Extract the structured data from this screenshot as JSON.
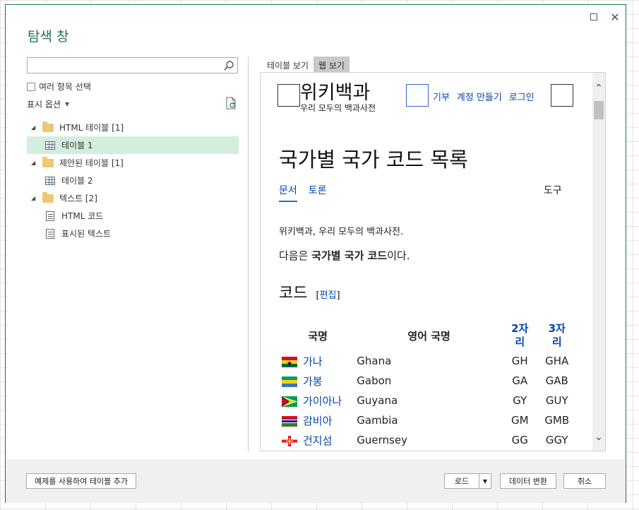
{
  "window": {
    "title": "탐색 창"
  },
  "left": {
    "search_placeholder": "",
    "multi_select_label": "여러 항목 선택",
    "display_options_label": "표시 옵션",
    "tree": [
      {
        "type": "folder",
        "label": "HTML 테이블 [1]"
      },
      {
        "type": "table",
        "label": "테이블 1",
        "selected": true
      },
      {
        "type": "folder",
        "label": "제안된 테이블 [1]"
      },
      {
        "type": "table",
        "label": "테이블 2"
      },
      {
        "type": "folder",
        "label": "텍스트 [2]"
      },
      {
        "type": "text",
        "label": "HTML 코드"
      },
      {
        "type": "text",
        "label": "표시된 텍스트"
      }
    ]
  },
  "right": {
    "tabs": [
      "테이블 보기",
      "웹 보기"
    ],
    "active_tab": "웹 보기"
  },
  "webpage": {
    "logo": "위키백과",
    "tagline": "우리 모두의 백과사전",
    "top_links": [
      "기부",
      "계정 만들기",
      "로그인"
    ],
    "heading": "국가별 국가 코드 목록",
    "page_tabs": [
      "문서",
      "토론"
    ],
    "tools": "도구",
    "intro": "위키백과, 우리 모두의 백과사전.",
    "lead_prefix": "다음은 ",
    "lead_bold": "국가별 국가 코드",
    "lead_suffix": "이다.",
    "section_title": "코드",
    "edit_label": "[편집]",
    "table_headers": [
      "국명",
      "영어 국명",
      "2자\n리",
      "3자\n리"
    ],
    "rows": [
      {
        "ko": "가나",
        "en": "Ghana",
        "a2": "GH",
        "a3": "GHA",
        "flag": "ghana"
      },
      {
        "ko": "가봉",
        "en": "Gabon",
        "a2": "GA",
        "a3": "GAB",
        "flag": "gabon"
      },
      {
        "ko": "가이아나",
        "en": "Guyana",
        "a2": "GY",
        "a3": "GUY",
        "flag": "guyana"
      },
      {
        "ko": "감비아",
        "en": "Gambia",
        "a2": "GM",
        "a3": "GMB",
        "flag": "gambia"
      },
      {
        "ko": "건지섬",
        "en": "Guernsey",
        "a2": "GG",
        "a3": "GGY",
        "flag": "guernsey"
      }
    ]
  },
  "footer": {
    "add_table_label": "예제를 사용하여 테이블 추가",
    "load_label": "로드",
    "transform_label": "데이터 변환",
    "cancel_label": "취소"
  },
  "colors": {
    "accent": "#217346",
    "selection": "#d3eedd",
    "link": "#0645ad"
  }
}
